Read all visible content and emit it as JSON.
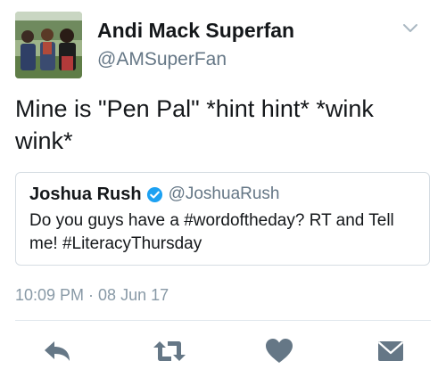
{
  "author": {
    "display_name": "Andi Mack Superfan",
    "handle": "@AMSuperFan"
  },
  "tweet": {
    "text": "Mine is \"Pen Pal\" *hint hint* *wink wink*",
    "timestamp": "10:09 PM · 08 Jun 17"
  },
  "quoted_tweet": {
    "display_name": "Joshua Rush",
    "handle": "@JoshuaRush",
    "verified": true,
    "text": "Do you guys have a #wordoftheday? RT and Tell me!  #LiteracyThursday"
  },
  "actions": [
    "reply-icon",
    "retweet-icon",
    "heart-icon",
    "envelope-icon"
  ],
  "icons": {
    "caret": "chevron-down-icon",
    "verified": "verified-badge-icon"
  },
  "colors": {
    "text": "#14171a",
    "secondary": "#657786",
    "action_icons": "#657786",
    "verified_blue": "#1da1f2",
    "border": "#d6dde3"
  }
}
